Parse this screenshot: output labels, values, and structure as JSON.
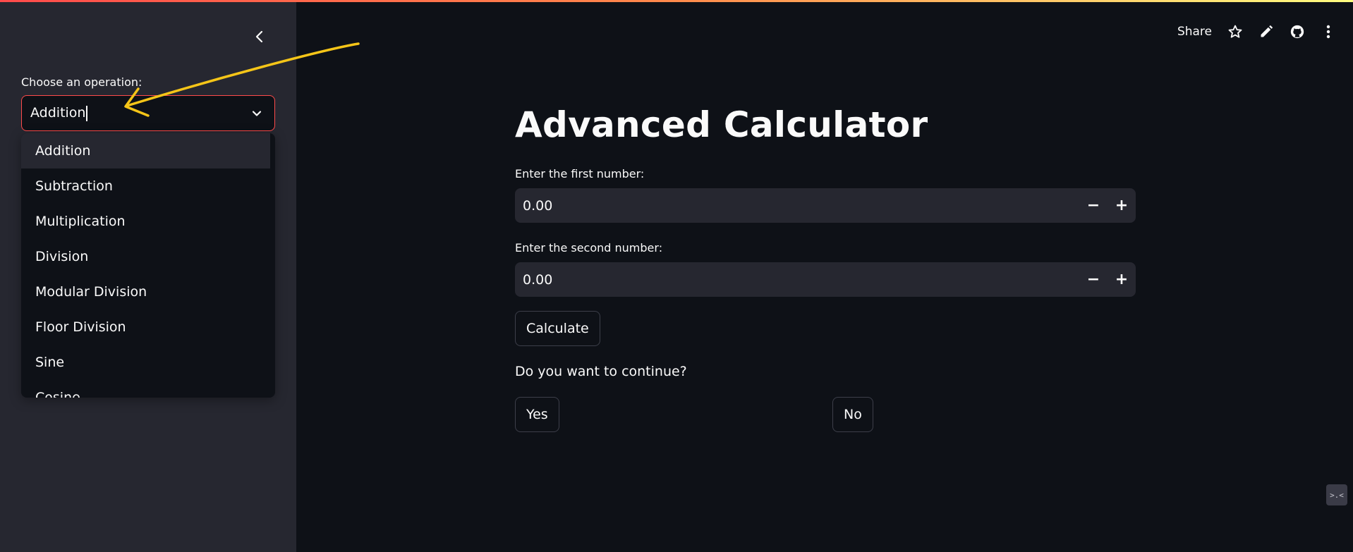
{
  "sidebar": {
    "operation_label": "Choose an operation:",
    "selected": "Addition",
    "options": [
      "Addition",
      "Subtraction",
      "Multiplication",
      "Division",
      "Modular Division",
      "Floor Division",
      "Sine",
      "Cosine"
    ]
  },
  "header": {
    "share_label": "Share",
    "icons": [
      "star-icon",
      "pencil-icon",
      "github-icon",
      "more-vertical-icon"
    ]
  },
  "main": {
    "title": "Advanced Calculator",
    "first_label": "Enter the first number:",
    "first_value": "0.00",
    "second_label": "Enter the second number:",
    "second_value": "0.00",
    "minus": "−",
    "plus": "+",
    "calculate_label": "Calculate",
    "continue_question": "Do you want to continue?",
    "yes_label": "Yes",
    "no_label": "No"
  },
  "colors": {
    "background": "#0e1117",
    "sidebar": "#262730",
    "accent": "#ff4b4b",
    "annotation": "#f5c518"
  }
}
